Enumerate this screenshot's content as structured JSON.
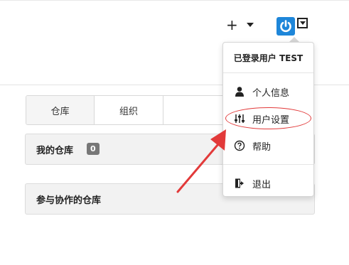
{
  "header": {
    "plus_symbol": "+",
    "accent_color": "#1e86d9"
  },
  "tabs": [
    {
      "label": "仓库"
    },
    {
      "label": "组织"
    },
    {
      "label": ""
    }
  ],
  "panels": {
    "my_repos": {
      "title": "我的仓库",
      "count": "0"
    },
    "collab_repos": {
      "title": "参与协作的仓库"
    }
  },
  "user_menu": {
    "header": "已登录用户 TEST",
    "items": [
      {
        "label": "个人信息",
        "icon": "user-icon"
      },
      {
        "label": "用户设置",
        "icon": "sliders-icon"
      },
      {
        "label": "帮助",
        "icon": "help-circle-icon"
      },
      {
        "label": "退出",
        "icon": "sign-out-icon"
      }
    ]
  },
  "annotation": {
    "color": "#e23a3a"
  }
}
